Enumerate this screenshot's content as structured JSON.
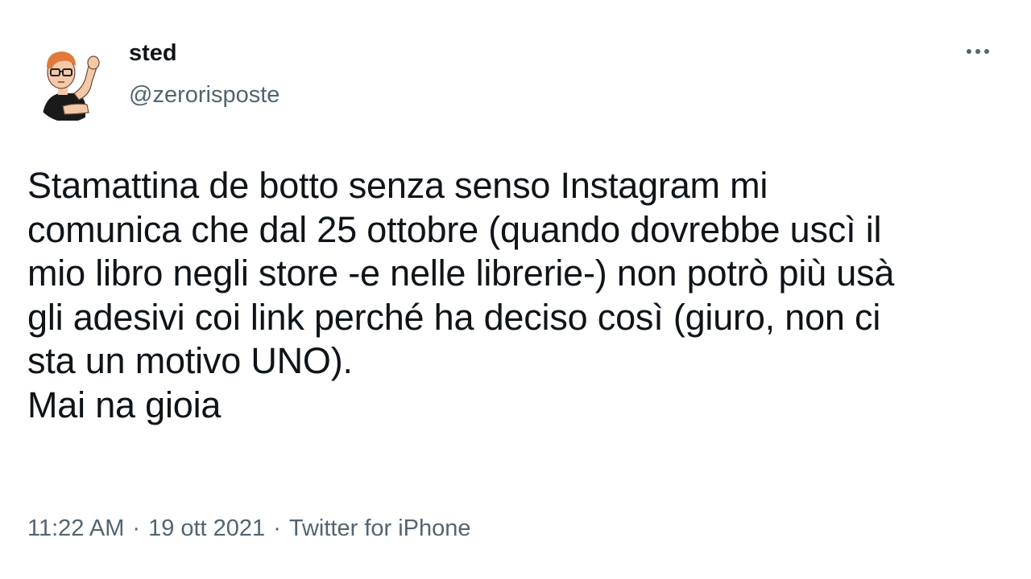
{
  "user": {
    "display_name": "sted",
    "handle": "@zerorisposte",
    "avatar_icon": "avatar-cartoon-flexing"
  },
  "tweet": {
    "text": "Stamattina de botto senza senso Instagram mi\ncomunica che dal 25 ottobre (quando dovrebbe uscì il\nmio libro negli store -e nelle librerie-) non potrò più usà\ngli adesivi coi link perché ha deciso così (giuro, non ci\nsta un motivo UNO).\nMai na gioia",
    "time": "11:22 AM",
    "date": "19 ott 2021",
    "source": "Twitter for iPhone",
    "separator": "·"
  },
  "icons": {
    "more": "more-horizontal-icon"
  },
  "colors": {
    "text_primary": "#0f1419",
    "text_secondary": "#536471",
    "background": "#ffffff"
  }
}
